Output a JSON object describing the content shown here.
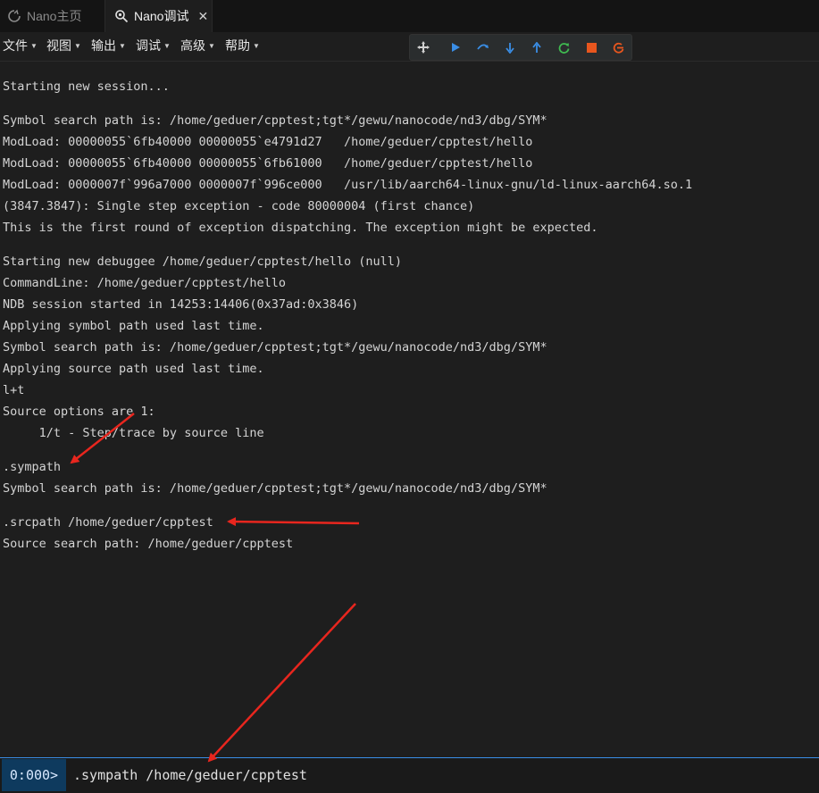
{
  "tabs": [
    {
      "label": "Nano主页",
      "active": false
    },
    {
      "label": "Nano调试",
      "active": true
    }
  ],
  "menu": [
    "文件",
    "视图",
    "输出",
    "调试",
    "高级",
    "帮助"
  ],
  "toolbar_icons": [
    "move-icon",
    "run-icon",
    "step-over-icon",
    "step-into-icon",
    "step-out-icon",
    "restart-icon",
    "stop-icon",
    "detach-icon"
  ],
  "console": [
    "Starting new session...",
    "Symbol search path is: /home/geduer/cpptest;tgt*/gewu/nanocode/nd3/dbg/SYM*",
    "ModLoad: 00000055`6fb40000 00000055`e4791d27   /home/geduer/cpptest/hello",
    "ModLoad: 00000055`6fb40000 00000055`6fb61000   /home/geduer/cpptest/hello",
    "ModLoad: 0000007f`996a7000 0000007f`996ce000   /usr/lib/aarch64-linux-gnu/ld-linux-aarch64.so.1",
    "(3847.3847): Single step exception - code 80000004 (first chance)",
    "This is the first round of exception dispatching. The exception might be expected.",
    "Starting new debuggee /home/geduer/cpptest/hello (null)",
    "CommandLine: /home/geduer/cpptest/hello",
    "NDB session started in 14253:14406(0x37ad:0x3846)",
    "Applying symbol path used last time.",
    "Symbol search path is: /home/geduer/cpptest;tgt*/gewu/nanocode/nd3/dbg/SYM*",
    "Applying source path used last time.",
    "l+t",
    "Source options are 1:",
    "     1/t - Step/trace by source line",
    ".sympath",
    "Symbol search path is: /home/geduer/cpptest;tgt*/gewu/nanocode/nd3/dbg/SYM*",
    ".srcpath /home/geduer/cpptest",
    "Source search path: /home/geduer/cpptest"
  ],
  "input": {
    "prompt": "0:000>",
    "value": ".sympath /home/geduer/cpptest"
  },
  "colors": {
    "accent": "#3a8ee6",
    "annotation_arrow": "#e8261e",
    "run": "#3a8ee6",
    "restart": "#3fb950",
    "stop": "#e8561e"
  }
}
